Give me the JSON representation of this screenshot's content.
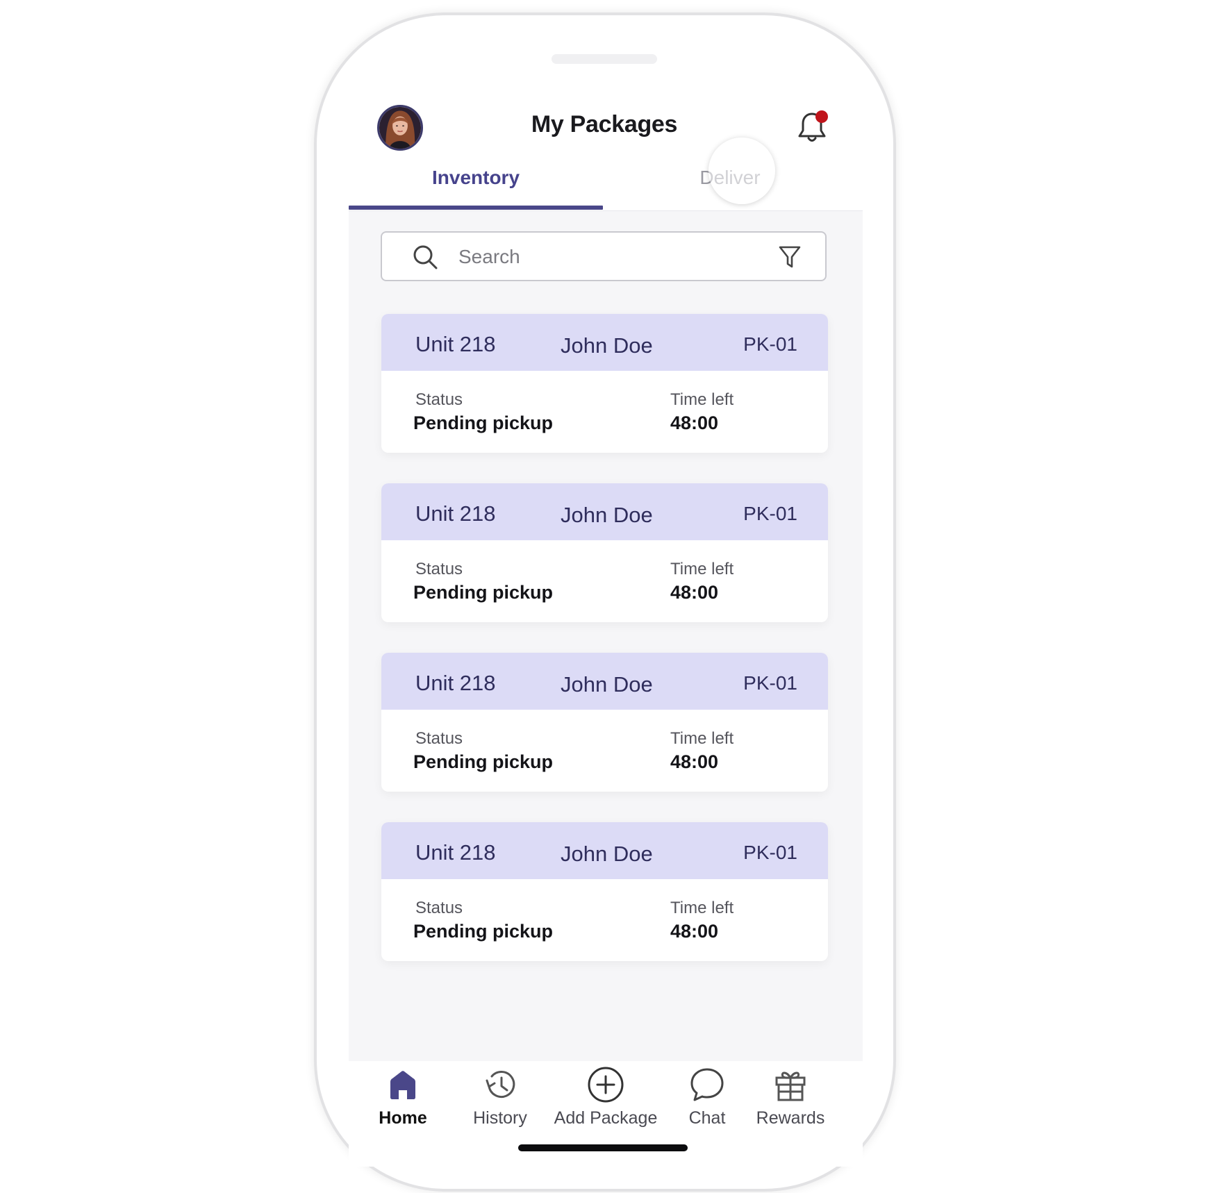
{
  "header": {
    "title": "My Packages",
    "avatar_icon": "user-avatar",
    "notification_icon": "bell-icon",
    "has_unread": true
  },
  "tabs": [
    {
      "label": "Inventory",
      "active": true
    },
    {
      "label": "Deliver",
      "active": false
    }
  ],
  "search": {
    "placeholder": "Search",
    "value": "",
    "search_icon": "search-icon",
    "filter_icon": "filter-icon"
  },
  "packages": [
    {
      "unit": "Unit 218",
      "name": "John Doe",
      "code": "PK-01",
      "status_label": "Status",
      "status": "Pending pickup",
      "time_label": "Time left",
      "time_left": "48:00"
    },
    {
      "unit": "Unit 218",
      "name": "John Doe",
      "code": "PK-01",
      "status_label": "Status",
      "status": "Pending pickup",
      "time_label": "Time left",
      "time_left": "48:00"
    },
    {
      "unit": "Unit 218",
      "name": "John Doe",
      "code": "PK-01",
      "status_label": "Status",
      "status": "Pending pickup",
      "time_label": "Time left",
      "time_left": "48:00"
    },
    {
      "unit": "Unit 218",
      "name": "John Doe",
      "code": "PK-01",
      "status_label": "Status",
      "status": "Pending pickup",
      "time_label": "Time left",
      "time_left": "48:00"
    }
  ],
  "nav": [
    {
      "label": "Home",
      "icon": "home-icon",
      "active": true
    },
    {
      "label": "History",
      "icon": "history-icon",
      "active": false
    },
    {
      "label": "Add Package",
      "icon": "add-circle-icon",
      "active": false
    },
    {
      "label": "Chat",
      "icon": "chat-bubble-icon",
      "active": false
    },
    {
      "label": "Rewards",
      "icon": "gift-icon",
      "active": false
    }
  ],
  "colors": {
    "accent": "#4a4789",
    "card_header": "#dcdbf6",
    "notification_dot": "#c0141b"
  }
}
